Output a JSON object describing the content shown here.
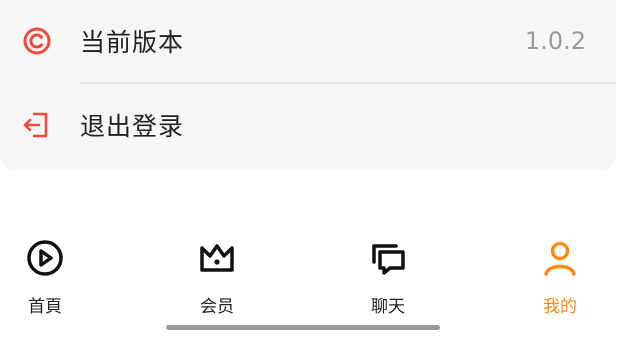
{
  "settings": {
    "items": [
      {
        "label": "当前版本",
        "value": "1.0.2",
        "icon": "copyright-icon"
      },
      {
        "label": "退出登录",
        "icon": "logout-icon"
      }
    ],
    "accent": "#ef4b3b"
  },
  "tabbar": {
    "tabs": [
      {
        "label": "首頁",
        "icon": "play-circle-icon"
      },
      {
        "label": "会员",
        "icon": "crown-icon"
      },
      {
        "label": "聊天",
        "icon": "chat-icon"
      },
      {
        "label": "我的",
        "icon": "person-icon",
        "active": true
      }
    ],
    "active_color": "#ff8a14"
  }
}
